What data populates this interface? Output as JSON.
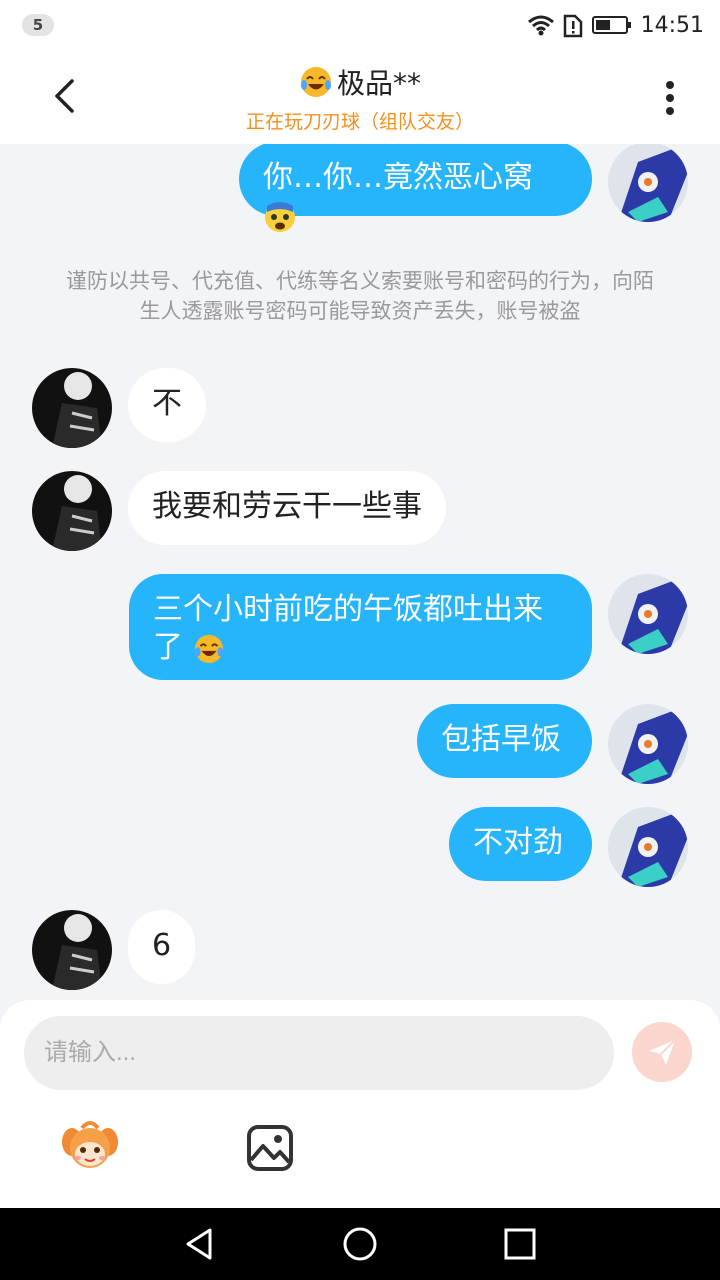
{
  "status_bar": {
    "notification_count": "5",
    "time": "14:51"
  },
  "header": {
    "title": "极品**",
    "subtitle": "正在玩刀刃球（组队交友）"
  },
  "notice": "谨防以共号、代充值、代练等名义索要账号和密码的行为，向陌生人透露账号密码可能导致资产丢失，账号被盗",
  "messages": [
    {
      "direction": "out",
      "text": "你…你…竟然恶心窝"
    },
    {
      "direction": "in",
      "text": "不"
    },
    {
      "direction": "in",
      "text": "我要和劳云干一些事"
    },
    {
      "direction": "out",
      "text_line1": "三个小时前吃的午饭都吐出来",
      "text_line2": "了"
    },
    {
      "direction": "out",
      "text": "包括早饭"
    },
    {
      "direction": "out",
      "text": "不对劲"
    },
    {
      "direction": "in",
      "text": "6"
    }
  ],
  "input": {
    "placeholder": "请输入..."
  },
  "icons": {
    "back": "chevron-left-icon",
    "more": "more-vertical-icon",
    "send": "send-icon",
    "mascot": "mascot-sticker-icon",
    "image": "image-icon",
    "emoji_laugh": "laughing-crying-emoji-icon",
    "emoji_fear": "fearful-emoji-icon"
  },
  "colors": {
    "accent_blue": "#26b4fb",
    "subtitle_orange": "#f5901e",
    "send_button": "#fbd6cf",
    "background": "#f2f4f8"
  }
}
